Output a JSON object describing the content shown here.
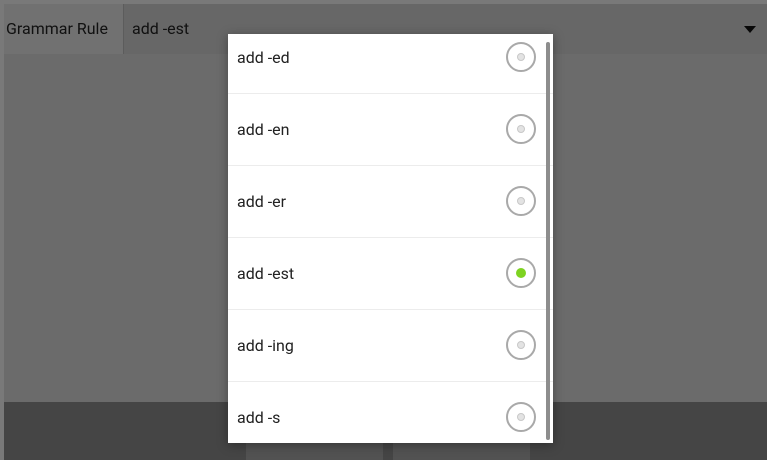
{
  "screen": {
    "label": "Grammar Rule",
    "spinner_value": "add -est"
  },
  "dialog": {
    "options": [
      {
        "label": "add -ed",
        "checked": false
      },
      {
        "label": "add -en",
        "checked": false
      },
      {
        "label": "add -er",
        "checked": false
      },
      {
        "label": "add -est",
        "checked": true
      },
      {
        "label": "add -ing",
        "checked": false
      },
      {
        "label": "add -s",
        "checked": false
      }
    ],
    "accent_color": "#7ed321"
  }
}
